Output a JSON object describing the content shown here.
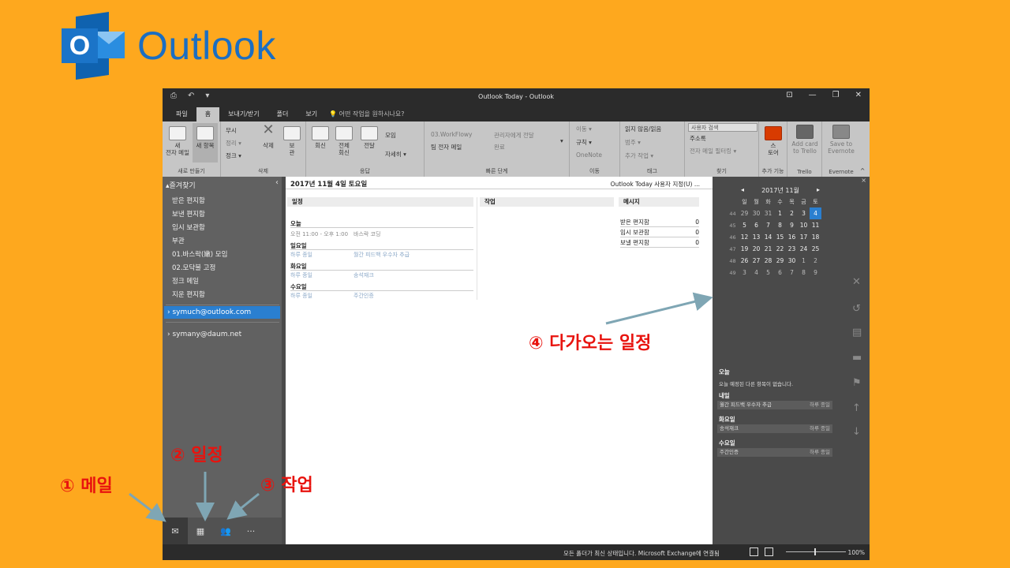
{
  "logo": {
    "text": "Outlook",
    "letter": "O"
  },
  "window": {
    "title": "Outlook Today  -  Outlook",
    "quick_access": [
      "⎙",
      "↶",
      "▾"
    ],
    "controls": [
      "⊡",
      "—",
      "❐",
      "✕"
    ]
  },
  "tabs": [
    {
      "label": "파일",
      "active": false
    },
    {
      "label": "홈",
      "active": true
    },
    {
      "label": "보내기/받기",
      "active": false
    },
    {
      "label": "폴더",
      "active": false
    },
    {
      "label": "보기",
      "active": false
    }
  ],
  "tell_me": "어떤 작업을 원하시나요?",
  "ribbon": {
    "new_group": {
      "new_mail": "새\n전자 메일",
      "new_items": "새 항목",
      "label": "새로 만들기"
    },
    "delete_group": {
      "ignore": "무시",
      "cleanup": "정리 ▾",
      "junk": "정크 ▾",
      "delete": "삭제",
      "archive": "보\n관",
      "label": "삭제"
    },
    "respond_group": {
      "reply": "회신",
      "reply_all": "전체\n회신",
      "forward": "전달",
      "meeting": "모임",
      "more": "자세히 ▾",
      "label": "응답"
    },
    "quicksteps": {
      "item1": "03.WorkFlowy",
      "item2": "관리자에게 전달",
      "item3": "팀 전자 메일",
      "item4": "완료",
      "label": "빠른 단계"
    },
    "move_group": {
      "move": "이동 ▾",
      "rules": "규칙 ▾",
      "onenote": "OneNote",
      "label": "이동"
    },
    "tags_group": {
      "unread": "읽지 않음/읽음",
      "categorize": "범주 ▾",
      "followup": "추가 작업 ▾",
      "label": "태그"
    },
    "find_group": {
      "search_people": "사용자 검색",
      "address_book": "주소록",
      "filter": "전자 메일 필터링 ▾",
      "label": "찾기"
    },
    "addins": {
      "store": "스\n토어",
      "label": "추가 기능"
    },
    "trello": {
      "add": "Add card\nto Trello",
      "label": "Trello"
    },
    "evernote": {
      "save": "Save to\nEvernote",
      "label": "Evernote"
    }
  },
  "nav": {
    "favorites": "▴즐겨찾기",
    "folders": [
      "받은 편지함",
      "보낸 편지함",
      "임시 보관함",
      "부관",
      "01.바스락(嫩) 모임",
      "02.모닥불 고정",
      "정크 메일",
      "지운 편지함"
    ],
    "accounts": [
      {
        "label": "symuch@outlook.com",
        "selected": true
      },
      {
        "label": "symany@daum.net",
        "selected": false
      }
    ],
    "bottom": [
      "mail-icon",
      "calendar-icon",
      "people-icon",
      "more-icon"
    ]
  },
  "today": {
    "date": "2017년 11월 4일 토요일",
    "customize": "Outlook Today 사용자 지정(U) ...",
    "calendar_header": "일정",
    "tasks_header": "작업",
    "messages_header": "메시지",
    "days": [
      {
        "day": "오늘",
        "items": [
          {
            "time": "오전 11:00 - 오후 1:00",
            "subject": "바스락 코딩"
          }
        ]
      },
      {
        "day": "일요일",
        "items": [
          {
            "time": "하루 종일",
            "subject": "월간 피드백 우수자 추급"
          }
        ]
      },
      {
        "day": "화요일",
        "items": [
          {
            "time": "하루 종일",
            "subject": "송석재크"
          }
        ]
      },
      {
        "day": "수요일",
        "items": [
          {
            "time": "하루 종일",
            "subject": "주간인증"
          }
        ]
      }
    ],
    "messages": [
      {
        "name": "받은 편지함",
        "count": "0"
      },
      {
        "name": "임시 보관함",
        "count": "0"
      },
      {
        "name": "보낼 편지함",
        "count": "0"
      }
    ]
  },
  "todo_bar": {
    "month": "2017년 11월",
    "prev": "◂",
    "next": "▸",
    "weekdays": [
      "일",
      "월",
      "화",
      "수",
      "목",
      "금",
      "토"
    ],
    "weeks": [
      {
        "wk": "44",
        "days": [
          "29",
          "30",
          "31",
          "1",
          "2",
          "3",
          "4"
        ]
      },
      {
        "wk": "45",
        "days": [
          "5",
          "6",
          "7",
          "8",
          "9",
          "10",
          "11"
        ]
      },
      {
        "wk": "46",
        "days": [
          "12",
          "13",
          "14",
          "15",
          "16",
          "17",
          "18"
        ]
      },
      {
        "wk": "47",
        "days": [
          "19",
          "20",
          "21",
          "22",
          "23",
          "24",
          "25"
        ]
      },
      {
        "wk": "48",
        "days": [
          "26",
          "27",
          "28",
          "29",
          "30",
          "1",
          "2"
        ]
      },
      {
        "wk": "49",
        "days": [
          "3",
          "4",
          "5",
          "6",
          "7",
          "8",
          "9"
        ]
      }
    ],
    "today_label": "오늘",
    "today_text": "오늘 예정된 다른 항목이 없습니다.",
    "upcoming": [
      {
        "day": "내일",
        "subject": "월간 피드백 우수자 추급",
        "when": "하루 종일"
      },
      {
        "day": "화요일",
        "subject": "송석재크",
        "when": "하루 종일"
      },
      {
        "day": "수요일",
        "subject": "주간인증",
        "when": "하루 종일"
      }
    ]
  },
  "status": {
    "text": "모든 폴더가 최신 상태입니다.    Microsoft Exchange에 연결됨",
    "zoom": "100%"
  },
  "annotations": {
    "mail": "① 메일",
    "calendar": "② 일정",
    "tasks": "③ 작업",
    "upcoming": "④ 다가오는 일정"
  },
  "colors": {
    "background": "#FEA81E",
    "annotation": "#E8130E",
    "accent": "#2A7FD0",
    "arrow": "#7FA6B4"
  }
}
